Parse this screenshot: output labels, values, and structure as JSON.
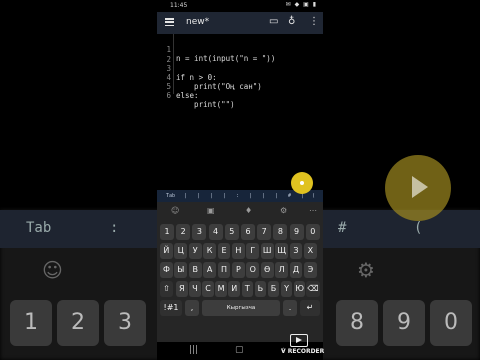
{
  "status": {
    "time": "11:45",
    "icons": "✉ ◆ ▣ ▮"
  },
  "app": {
    "title": "new*",
    "icons": [
      "menu-icon",
      "folder-icon",
      "lightbulb-icon",
      "more-vert-icon"
    ]
  },
  "editor": {
    "lines": [
      {
        "num": "1",
        "code": "n = int(input(\"n = \"))"
      },
      {
        "num": "2",
        "code": ""
      },
      {
        "num": "3",
        "code": "if n > 0:"
      },
      {
        "num": "4",
        "code": "    print(\"Оң сан\")"
      },
      {
        "num": "5",
        "code": "else:"
      },
      {
        "num": "6",
        "code": "    print(\"\")"
      }
    ]
  },
  "symbol_bar": [
    "Tab",
    "|",
    "|",
    "|",
    "|",
    ":",
    "|",
    "|",
    "|",
    "#",
    "|",
    "("
  ],
  "keyboard": {
    "toolbar_icons": [
      "emoji-icon",
      "sticker-icon",
      "mic-icon",
      "settings-icon",
      "more-icon"
    ],
    "row_numbers": [
      "1",
      "2",
      "3",
      "4",
      "5",
      "6",
      "7",
      "8",
      "9",
      "0"
    ],
    "row1": [
      "Й",
      "Ц",
      "У",
      "К",
      "Е",
      "Н",
      "Г",
      "Ш",
      "Щ",
      "З",
      "Х"
    ],
    "row2": [
      "Ф",
      "Ы",
      "В",
      "А",
      "П",
      "Р",
      "О",
      "Ө",
      "Л",
      "Д",
      "Э"
    ],
    "row3": [
      "Я",
      "Ч",
      "С",
      "М",
      "И",
      "Т",
      "Ь",
      "Б",
      "Ү",
      "Ю"
    ],
    "bottom": {
      "sym": "!#1",
      "comma": ",",
      "space": "Кыргызча",
      "period": ".",
      "enter": "↵"
    }
  },
  "background": {
    "strip": [
      "Tab",
      ":",
      "#",
      "("
    ],
    "keys": [
      "1",
      "2",
      "3",
      "8",
      "9",
      "0"
    ]
  },
  "watermark": "V RECORDER",
  "colors": {
    "appbar": "#1f2633",
    "fab": "#e0c220",
    "keyboard": "#262626"
  }
}
